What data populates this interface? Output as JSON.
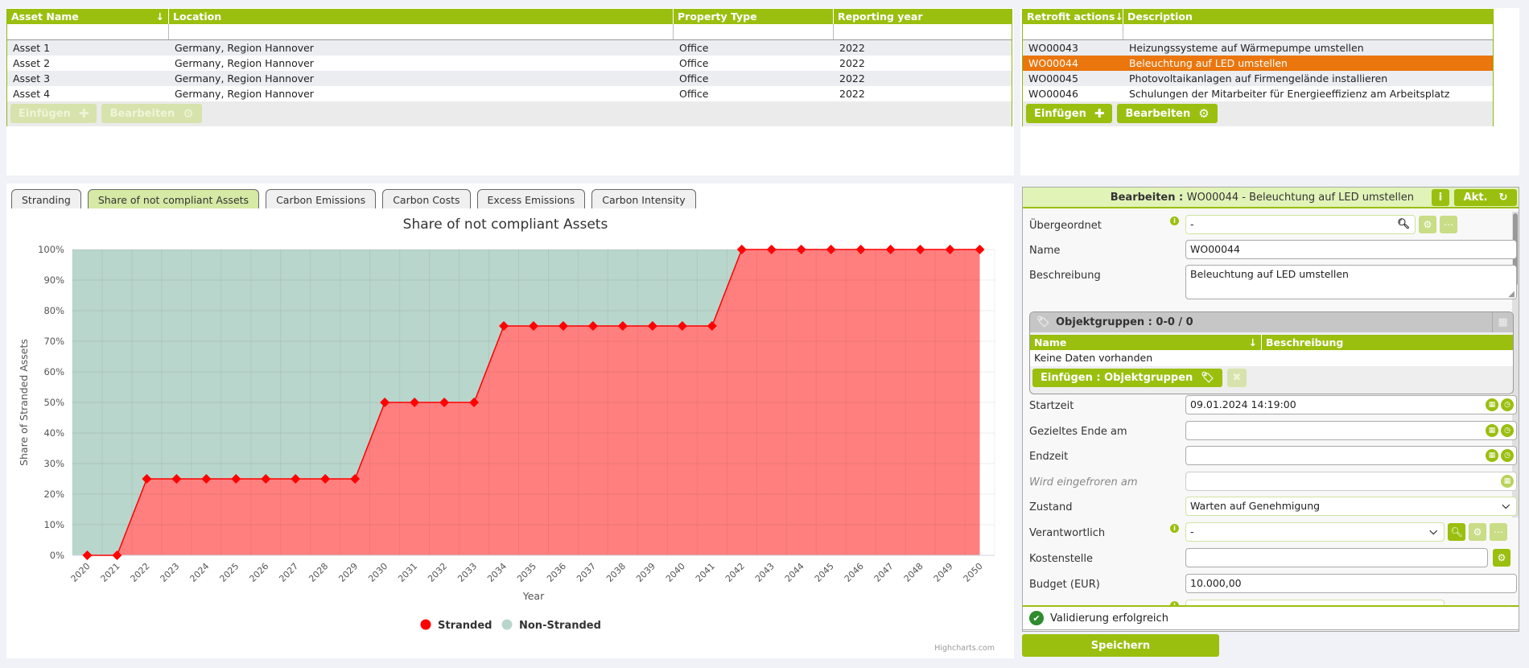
{
  "assets_table": {
    "columns": [
      "Asset Name",
      "Location",
      "Property Type",
      "Reporting year"
    ],
    "rows": [
      [
        "Asset 1",
        "Germany, Region Hannover",
        "Office",
        "2022"
      ],
      [
        "Asset 2",
        "Germany, Region Hannover",
        "Office",
        "2022"
      ],
      [
        "Asset 3",
        "Germany, Region Hannover",
        "Office",
        "2022"
      ],
      [
        "Asset 4",
        "Germany, Region Hannover",
        "Office",
        "2022"
      ]
    ],
    "insert_label": "Einfügen",
    "edit_label": "Bearbeiten"
  },
  "retrofit_table": {
    "columns": [
      "Retrofit actions",
      "Description"
    ],
    "rows": [
      [
        "WO00043",
        "Heizungssysteme auf Wärmepumpe umstellen"
      ],
      [
        "WO00044",
        "Beleuchtung auf LED umstellen"
      ],
      [
        "WO00045",
        "Photovoltaikanlagen auf Firmengelände installieren"
      ],
      [
        "WO00046",
        "Schulungen der Mitarbeiter für Energieeffizienz am Arbeitsplatz"
      ]
    ],
    "selected_index": 1,
    "insert_label": "Einfügen",
    "edit_label": "Bearbeiten"
  },
  "tabs": [
    {
      "label": "Stranding",
      "active": false
    },
    {
      "label": "Share of not compliant Assets",
      "active": true
    },
    {
      "label": "Carbon Emissions",
      "active": false
    },
    {
      "label": "Carbon Costs",
      "active": false
    },
    {
      "label": "Excess Emissions",
      "active": false
    },
    {
      "label": "Carbon Intensity",
      "active": false
    }
  ],
  "chart_data": {
    "type": "area",
    "stacking": "percent",
    "title": "Share of not compliant Assets",
    "xlabel": "Year",
    "ylabel": "Share of Stranded Assets",
    "ylim": [
      0,
      100
    ],
    "yticks": [
      "0%",
      "10%",
      "20%",
      "30%",
      "40%",
      "50%",
      "60%",
      "70%",
      "80%",
      "90%",
      "100%"
    ],
    "x": [
      "2020",
      "2021",
      "2022",
      "2023",
      "2024",
      "2025",
      "2026",
      "2027",
      "2028",
      "2029",
      "2030",
      "2031",
      "2032",
      "2033",
      "2034",
      "2035",
      "2036",
      "2037",
      "2038",
      "2039",
      "2040",
      "2041",
      "2042",
      "2043",
      "2044",
      "2045",
      "2046",
      "2047",
      "2048",
      "2049",
      "2050"
    ],
    "series": [
      {
        "name": "Stranded",
        "color": "#ff0000",
        "fill": "#ff7f7f",
        "values": [
          0,
          0,
          25,
          25,
          25,
          25,
          25,
          25,
          25,
          25,
          50,
          50,
          50,
          50,
          75,
          75,
          75,
          75,
          75,
          75,
          75,
          75,
          100,
          100,
          100,
          100,
          100,
          100,
          100,
          100,
          100
        ]
      },
      {
        "name": "Non-Stranded",
        "color": "#b9d6cc",
        "fill": "#b9d6cc",
        "values": [
          100,
          100,
          75,
          75,
          75,
          75,
          75,
          75,
          75,
          75,
          50,
          50,
          50,
          50,
          25,
          25,
          25,
          25,
          25,
          25,
          25,
          25,
          0,
          0,
          0,
          0,
          0,
          0,
          0,
          0,
          0
        ]
      }
    ],
    "grid": true,
    "legend": "bottom-center",
    "credits": "Highcharts.com"
  },
  "edit_panel": {
    "title_prefix": "Bearbeiten :",
    "title_value": "WO00044 - Beleuchtung auf LED umstellen",
    "refresh_label": "Akt.",
    "fields": {
      "parent": {
        "label": "Übergeordnet",
        "value": "-"
      },
      "name": {
        "label": "Name",
        "value": "WO00044"
      },
      "description": {
        "label": "Beschreibung",
        "value": "Beleuchtung auf LED umstellen"
      },
      "start": {
        "label": "Startzeit",
        "value": "09.01.2024 14:19:00"
      },
      "target_end": {
        "label": "Gezieltes Ende am",
        "value": ""
      },
      "end": {
        "label": "Endzeit",
        "value": ""
      },
      "frozen": {
        "label": "Wird eingefroren am",
        "value": ""
      },
      "state": {
        "label": "Zustand",
        "value": "Warten auf Genehmigung"
      },
      "responsible": {
        "label": "Verantwortlich",
        "value": "-"
      },
      "cost_center": {
        "label": "Kostenstelle",
        "value": ""
      },
      "budget": {
        "label": "Budget (EUR)",
        "value": "10.000,00"
      }
    },
    "object_groups": {
      "title": "Objektgruppen : 0-0 / 0",
      "columns": [
        "Name",
        "Beschreibung"
      ],
      "empty_text": "Keine Daten vorhanden",
      "insert_label": "Einfügen : Objektgruppen"
    }
  },
  "validation": {
    "text": "Validierung erfolgreich"
  },
  "save_label": "Speichern"
}
